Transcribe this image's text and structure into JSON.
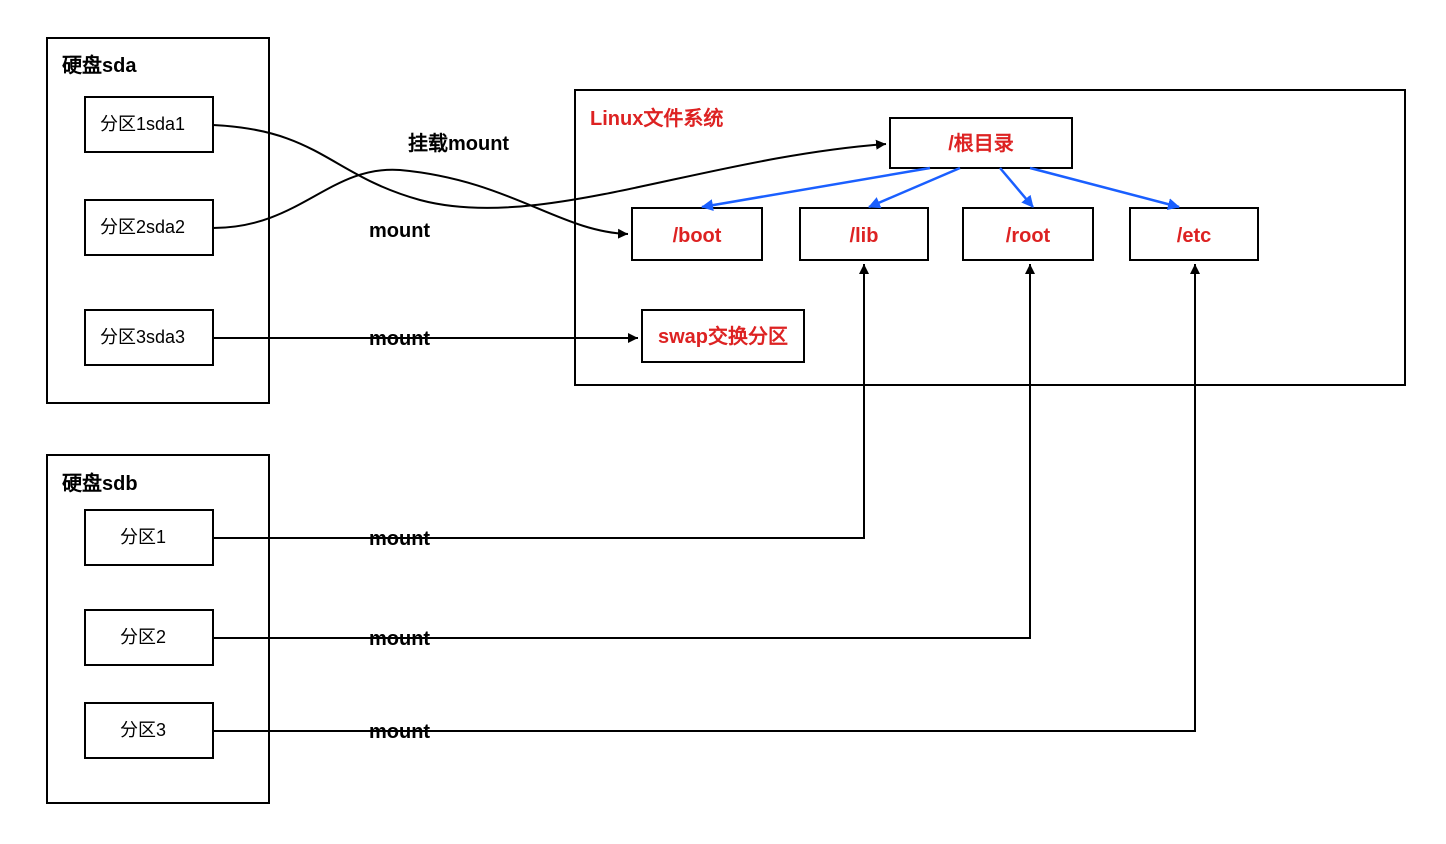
{
  "disks": {
    "sda": {
      "title": "硬盘sda",
      "partitions": [
        "分区1sda1",
        "分区2sda2",
        "分区3sda3"
      ]
    },
    "sdb": {
      "title": "硬盘sdb",
      "partitions": [
        "分区1",
        "分区2",
        "分区3"
      ]
    }
  },
  "mount_labels": {
    "sda1": "挂载mount",
    "sda2": "mount",
    "sda3": "mount",
    "sdb1": "mount",
    "sdb2": "mount",
    "sdb3": "mount"
  },
  "filesystem": {
    "title": "Linux文件系统",
    "root": "/根目录",
    "dirs": [
      "/boot",
      "/lib",
      "/root",
      "/etc"
    ],
    "swap": "swap交换分区"
  },
  "mounts": [
    {
      "source": "sda.分区1sda1",
      "target": "/根目录"
    },
    {
      "source": "sda.分区2sda2",
      "target": "/boot"
    },
    {
      "source": "sda.分区3sda3",
      "target": "swap交换分区"
    },
    {
      "source": "sdb.分区1",
      "target": "/lib"
    },
    {
      "source": "sdb.分区2",
      "target": "/root"
    },
    {
      "source": "sdb.分区3",
      "target": "/etc"
    }
  ]
}
